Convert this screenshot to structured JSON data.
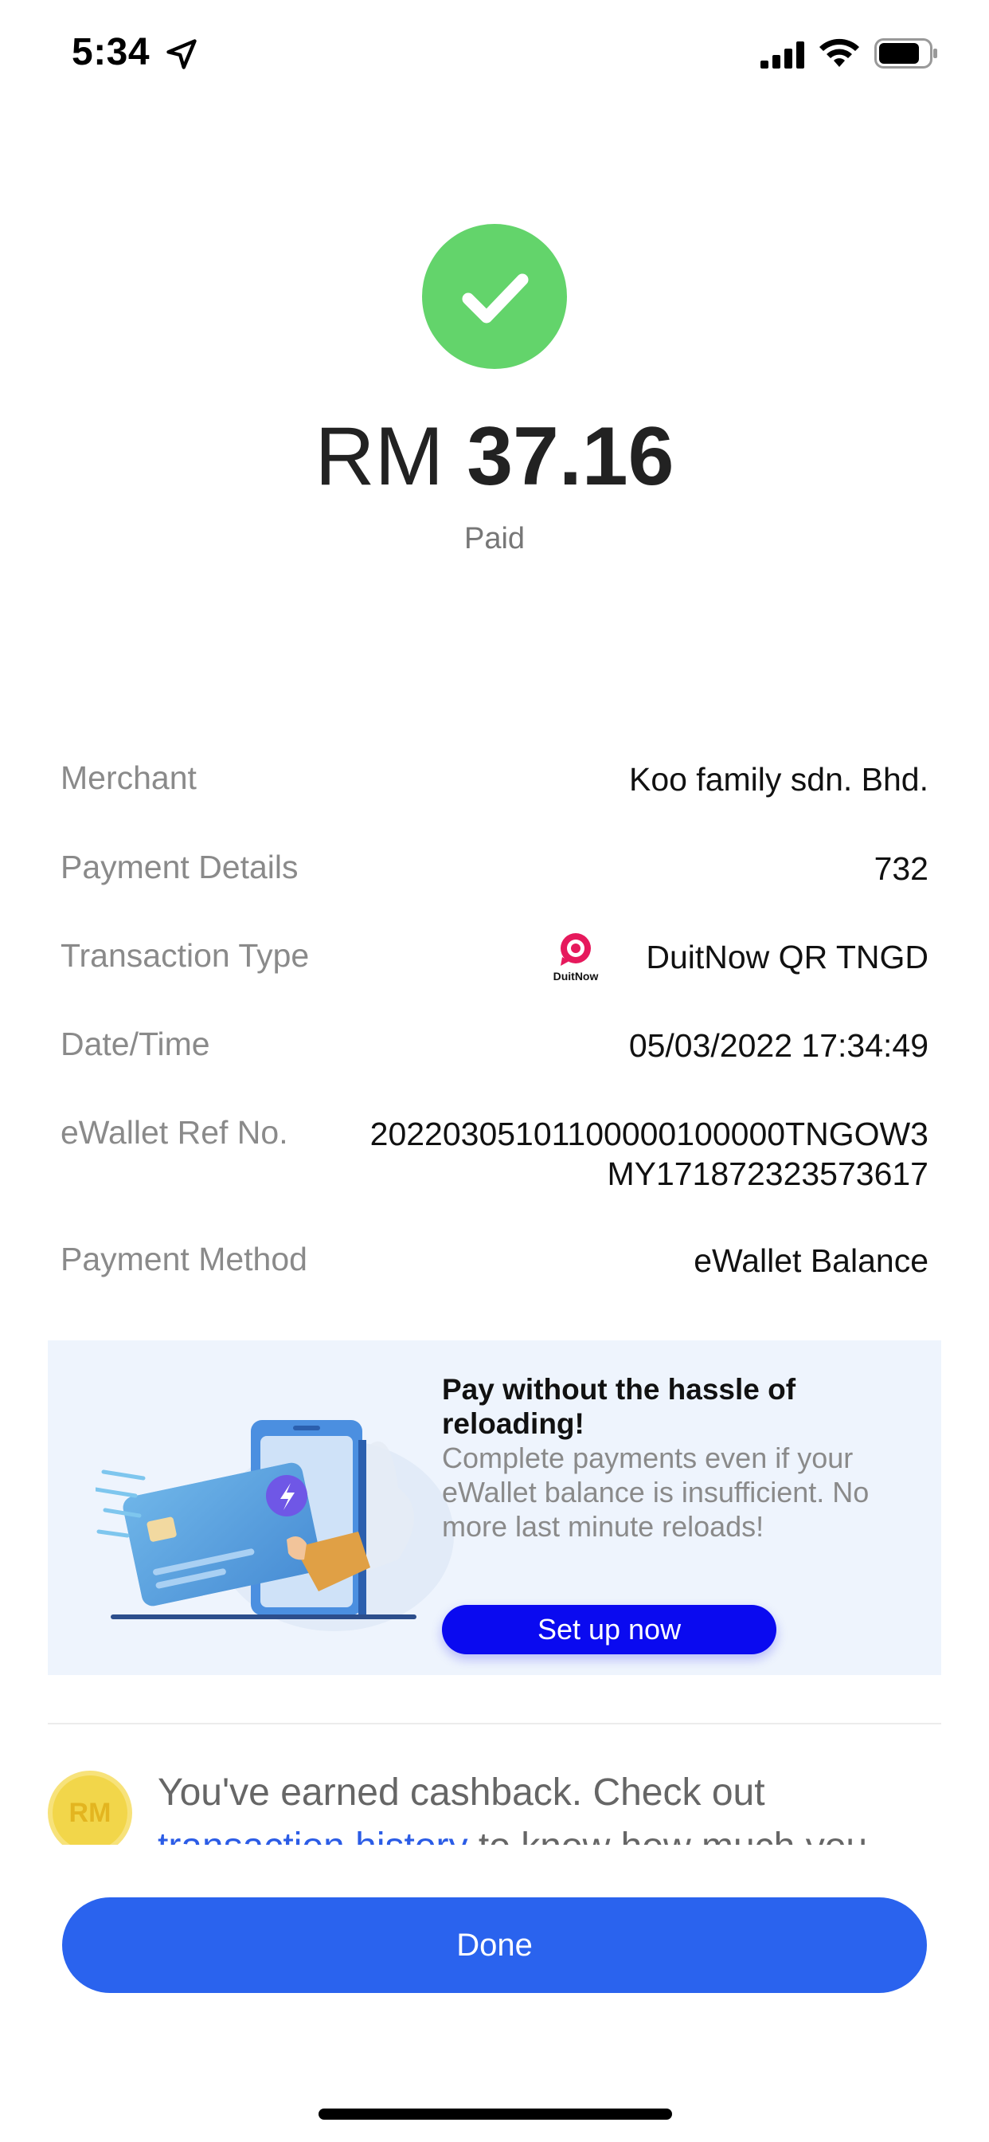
{
  "status_bar": {
    "time": "5:34",
    "icons": [
      "location-arrow-icon",
      "cellular-signal-icon",
      "wifi-icon",
      "battery-icon"
    ]
  },
  "receipt": {
    "currency": "RM",
    "amount": "37.16",
    "status": "Paid",
    "status_color": "#63d46b"
  },
  "details": {
    "merchant": {
      "label": "Merchant",
      "value": "Koo family sdn. Bhd."
    },
    "payment_details": {
      "label": "Payment Details",
      "value": "732"
    },
    "transaction_type": {
      "label": "Transaction Type",
      "value": "DuitNow QR TNGD",
      "logo_text": "DuitNow"
    },
    "datetime": {
      "label": "Date/Time",
      "value": "05/03/2022 17:34:49"
    },
    "ref_no": {
      "label": "eWallet Ref No.",
      "value_line1": "20220305101100000100000TNGOW3",
      "value_line2": "MY171872323573617"
    },
    "payment_method": {
      "label": "Payment Method",
      "value": "eWallet Balance"
    }
  },
  "promo": {
    "title": "Pay without the hassle of reloading!",
    "description": "Complete payments even if your eWallet balance is insufficient. No more last minute reloads!",
    "button_label": "Set up now",
    "button_color": "#0a0af0"
  },
  "cashback": {
    "coin_label": "RM",
    "text_before": "You've earned cashback. Check out ",
    "link_text": "transaction history",
    "text_after": " to know how much you"
  },
  "footer": {
    "done_label": "Done",
    "done_color": "#2a63ee"
  }
}
